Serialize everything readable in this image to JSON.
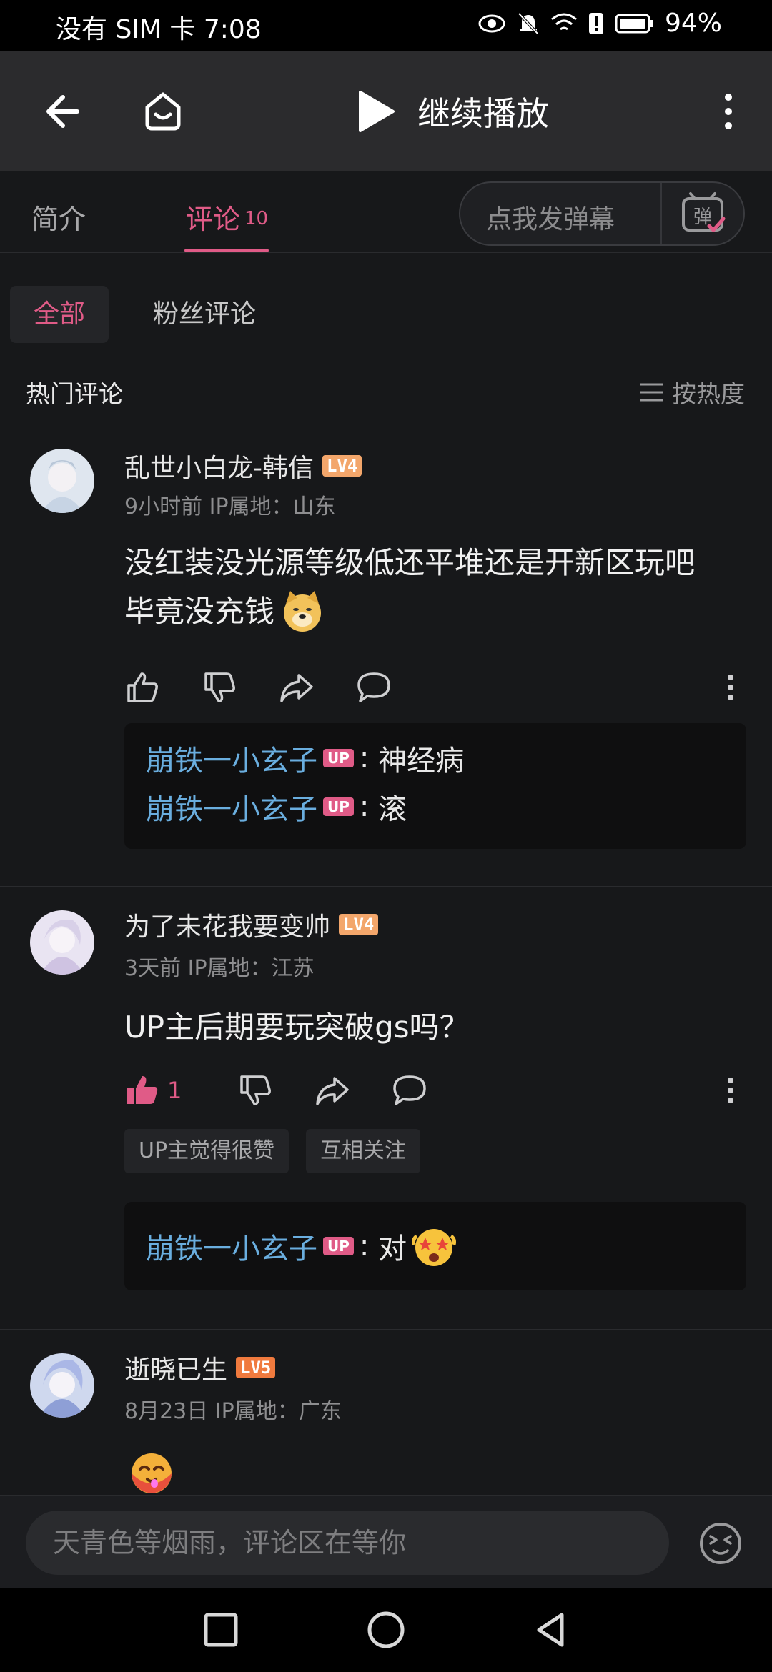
{
  "status_bar": {
    "carrier_time": "没有 SIM 卡 7:08",
    "battery": "94%"
  },
  "top_bar": {
    "back_icon": "arrow-left-icon",
    "home_icon": "home-tv-icon",
    "play_icon": "play-icon",
    "title": "继续播放",
    "more_icon": "more-vertical-icon"
  },
  "tabs": {
    "intro": "简介",
    "comments": "评论",
    "comments_count": "10",
    "danmu_placeholder": "点我发弹幕",
    "danmu_icon": "danmu-toggle-icon"
  },
  "filter": {
    "all": "全部",
    "fans": "粉丝评论"
  },
  "section": {
    "title": "热门评论",
    "sort_label": "按热度"
  },
  "comments": [
    {
      "username": "乱世小白龙-韩信",
      "level": "LV4",
      "meta": "9小时前 IP属地：山东",
      "text_line1": "没红装没光源等级低还平堆还是开新区玩吧",
      "text_line2": "毕竟没充钱",
      "emoji": "doge-emoji",
      "replies": [
        {
          "name": "崩铁一小玄子",
          "badge": "UP",
          "text": "神经病"
        },
        {
          "name": "崩铁一小玄子",
          "badge": "UP",
          "text": "滚"
        }
      ]
    },
    {
      "username": "为了未花我要变帅",
      "level": "LV4",
      "meta": "3天前 IP属地：江苏",
      "text": "UP主后期要玩突破gs吗？",
      "like_count": "1",
      "tags": [
        "UP主觉得很赞",
        "互相关注"
      ],
      "replies": [
        {
          "name": "崩铁一小玄子",
          "badge": "UP",
          "text": "对",
          "emoji": "starry-eyed-emoji"
        }
      ]
    },
    {
      "username": "逝晓已生",
      "level": "LV5",
      "meta": "8月23日 IP属地：广东",
      "emoji": "hot-face-emoji"
    }
  ],
  "bottom": {
    "placeholder": "天青色等烟雨，评论区在等你",
    "emoji_button": "emoji-face-icon"
  },
  "colors": {
    "accent": "#e05b87",
    "reply_name": "#6aaedf",
    "background": "#17181a"
  }
}
